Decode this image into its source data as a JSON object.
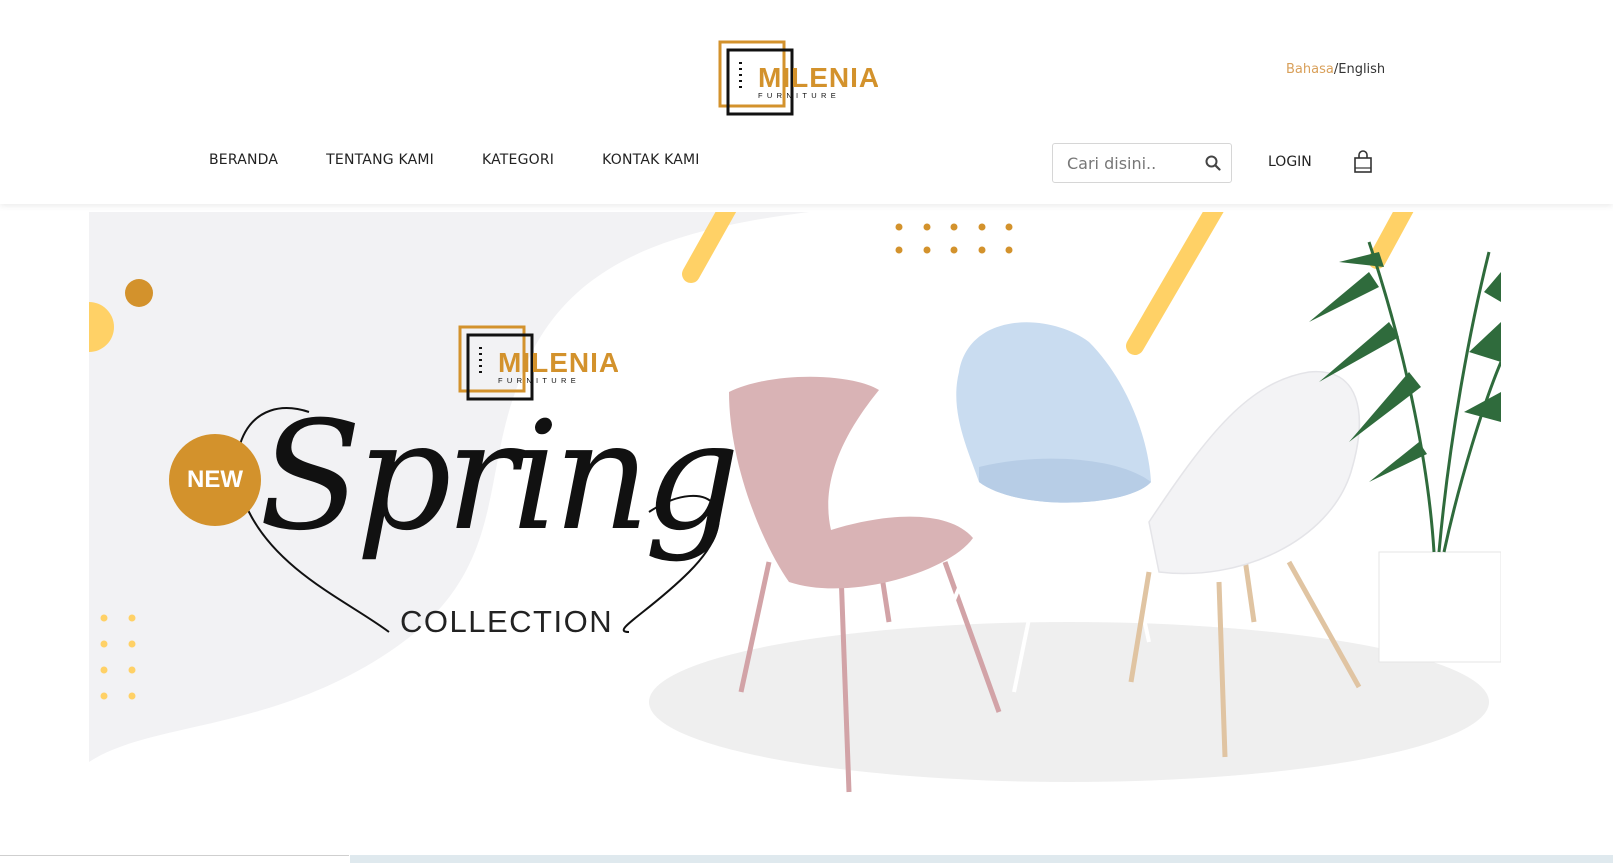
{
  "brand": {
    "name": "MILENIA",
    "tagline": "FURNITURE",
    "gold": "#d3922c",
    "dark": "#111111"
  },
  "language": {
    "active": "Bahasa",
    "separator": "/",
    "other": "English"
  },
  "nav": {
    "items": [
      "BERANDA",
      "TENTANG KAMI",
      "KATEGORI",
      "KONTAK KAMI"
    ]
  },
  "search": {
    "placeholder": "Cari disini..",
    "icon": "search-icon"
  },
  "login_label": "LOGIN",
  "cart": {
    "icon": "shopping-bag-icon"
  },
  "banner": {
    "badge": "NEW",
    "headline": "Spring",
    "subheadline": "COLLECTION",
    "colors": {
      "accent_yellow": "#ffd166",
      "accent_gold": "#d3922c",
      "blob_gray": "#f2f2f4",
      "chair_pink": "#d9b3b5",
      "chair_blue": "#c9dcf0",
      "plant_green": "#2f6b3c"
    }
  }
}
